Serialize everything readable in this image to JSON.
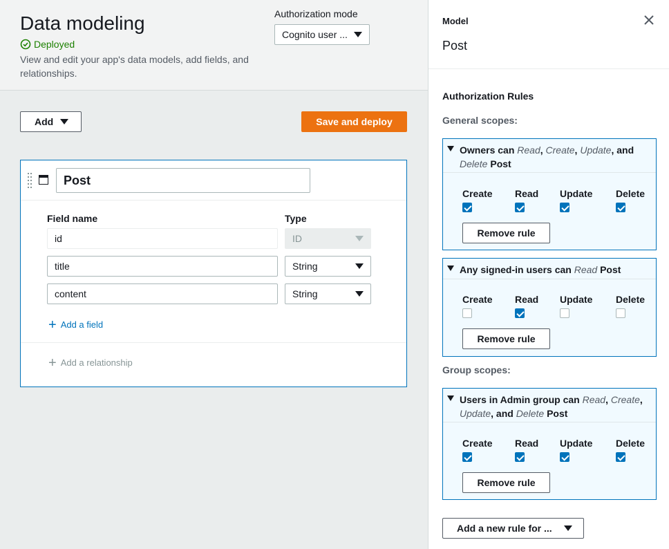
{
  "header": {
    "title": "Data modeling",
    "status": "Deployed",
    "description": "View and edit your app's data models, add fields, and relationships.",
    "auth_label": "Authorization mode",
    "auth_value": "Cognito user ..."
  },
  "toolbar": {
    "add_label": "Add",
    "save_label": "Save and deploy"
  },
  "model": {
    "name": "Post",
    "col_field": "Field name",
    "col_type": "Type",
    "fields": [
      {
        "name": "id",
        "type": "ID"
      },
      {
        "name": "title",
        "type": "String"
      },
      {
        "name": "content",
        "type": "String"
      }
    ],
    "add_field": "Add a field",
    "add_relationship": "Add a relationship"
  },
  "panel": {
    "label": "Model",
    "title": "Post",
    "auth_rules": "Authorization Rules",
    "general_scopes": "General scopes:",
    "group_scopes": "Group scopes:",
    "perm_labels": [
      "Create",
      "Read",
      "Update",
      "Delete"
    ],
    "remove_label": "Remove rule",
    "new_rule_label": "Add a new rule for ...",
    "rules": [
      {
        "text_a": "Owners can ",
        "i1": "Read",
        "sep1": ", ",
        "i2": "Create",
        "sep2": ", ",
        "i3": "Update",
        "sep3": ", and",
        "i4": "Delete",
        "tail": " Post",
        "checked": [
          true,
          true,
          true,
          true
        ]
      },
      {
        "text_a": "Any signed-in users can ",
        "i1": "Read",
        "tail": " Post",
        "checked": [
          false,
          true,
          false,
          false
        ]
      },
      {
        "text_a": "Users in Admin group can ",
        "i1": "Read",
        "sep1": ", ",
        "i2": "Create",
        "sep2": ",",
        "i3": "Update",
        "sep3": ", and ",
        "i4": "Delete",
        "tail": " Post",
        "checked": [
          true,
          true,
          true,
          true
        ]
      }
    ]
  },
  "colors": {
    "accent": "#0073bb",
    "primary_button": "#ec7211",
    "success": "#1d8102"
  }
}
